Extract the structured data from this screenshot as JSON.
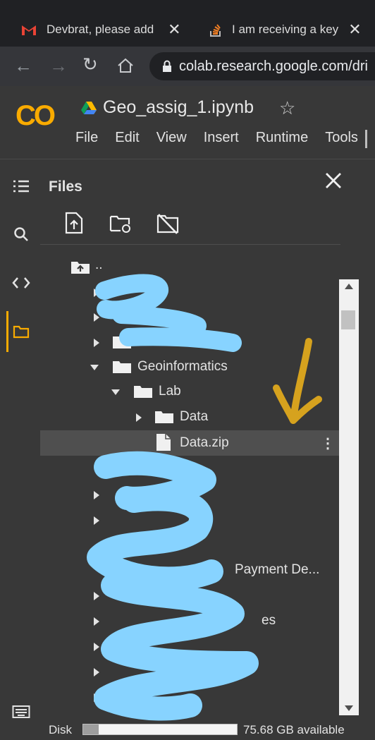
{
  "tabs": [
    {
      "title": "Devbrat, please add",
      "icon": "gmail-icon"
    },
    {
      "title": "I am receiving a key",
      "icon": "stackoverflow-icon"
    }
  ],
  "address": {
    "url": "colab.research.google.com/dri"
  },
  "notebook": {
    "logo": "CO",
    "title": "Geo_assig_1.ipynb"
  },
  "menu": [
    "File",
    "Edit",
    "View",
    "Insert",
    "Runtime",
    "Tools"
  ],
  "files_panel": {
    "title": "Files",
    "parent_dir": "..",
    "tree": {
      "geoinformatics": "Geoinformatics",
      "lab": "Lab",
      "data_folder": "Data",
      "data_zip": "Data.zip",
      "partial_payment": "Payment De...",
      "partial_ures": "ures",
      "partial_es": "es"
    }
  },
  "disk": {
    "label": "Disk",
    "available": "75.68 GB available",
    "used_fraction": 0.1
  },
  "colors": {
    "colab_orange": "#f9ab00",
    "redaction_blue": "#87d3ff",
    "arrow_gold": "#d6a21e"
  }
}
